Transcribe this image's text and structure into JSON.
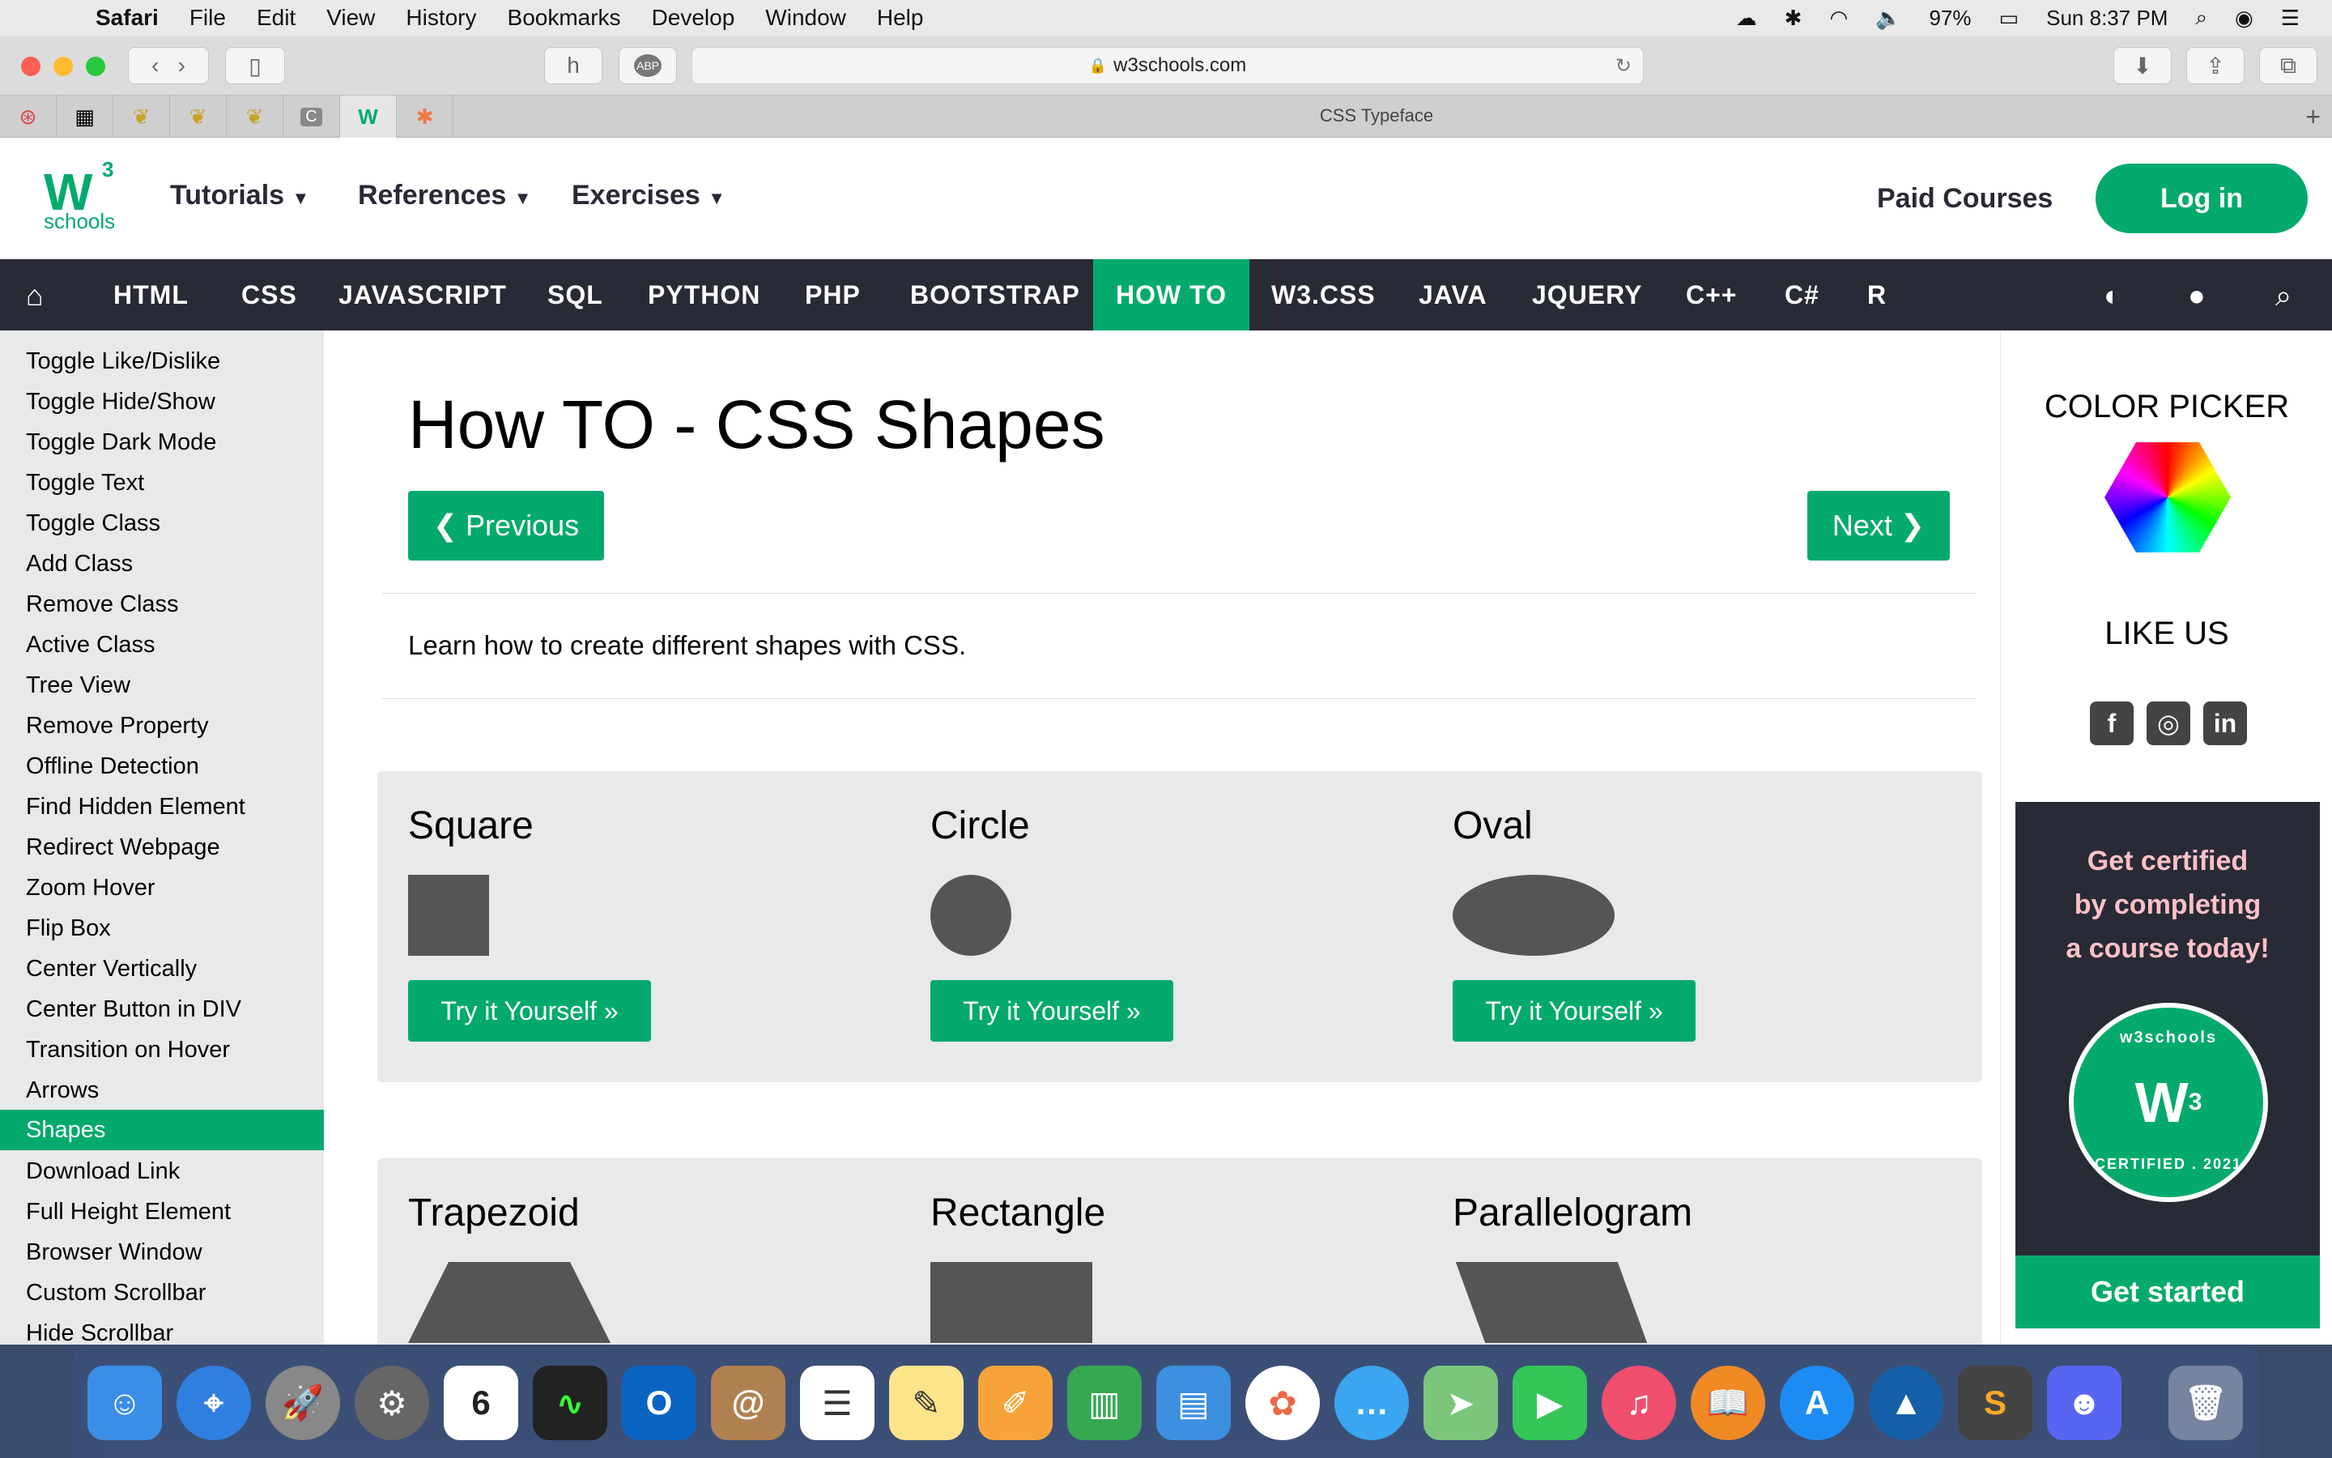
{
  "menubar": {
    "app": "Safari",
    "items": [
      "File",
      "Edit",
      "View",
      "History",
      "Bookmarks",
      "Develop",
      "Window",
      "Help"
    ],
    "battery": "97%",
    "clock": "Sun 8:37 PM"
  },
  "browser": {
    "url": "w3schools.com",
    "tab_title": "CSS Typeface"
  },
  "site": {
    "logo_text": "schools",
    "logo_mark": "W",
    "logo_sup": "3",
    "top_menu": [
      "Tutorials",
      "References",
      "Exercises"
    ],
    "paid_courses": "Paid Courses",
    "login": "Log in",
    "nav": [
      "HTML",
      "CSS",
      "JAVASCRIPT",
      "SQL",
      "PYTHON",
      "PHP",
      "BOOTSTRAP",
      "HOW TO",
      "W3.CSS",
      "JAVA",
      "JQUERY",
      "C++",
      "C#",
      "R"
    ],
    "nav_active": "HOW TO"
  },
  "sidebar": {
    "links": [
      "Toggle Like/Dislike",
      "Toggle Hide/Show",
      "Toggle Dark Mode",
      "Toggle Text",
      "Toggle Class",
      "Add Class",
      "Remove Class",
      "Active Class",
      "Tree View",
      "Remove Property",
      "Offline Detection",
      "Find Hidden Element",
      "Redirect Webpage",
      "Zoom Hover",
      "Flip Box",
      "Center Vertically",
      "Center Button in DIV",
      "Transition on Hover",
      "Arrows",
      "Shapes",
      "Download Link",
      "Full Height Element",
      "Browser Window",
      "Custom Scrollbar",
      "Hide Scrollbar"
    ],
    "active": "Shapes"
  },
  "main": {
    "title": "How TO - CSS Shapes",
    "previous": "❮ Previous",
    "next": "Next ❯",
    "intro": "Learn how to create different shapes with CSS.",
    "shapes_row1": [
      "Square",
      "Circle",
      "Oval"
    ],
    "shapes_row2": [
      "Trapezoid",
      "Rectangle",
      "Parallelogram"
    ],
    "try_label": "Try it Yourself »"
  },
  "right": {
    "color_picker": "COLOR PICKER",
    "like_us": "LIKE US",
    "cert_line1": "Get certified",
    "cert_line2": "by completing",
    "cert_line3": "a course today!",
    "badge_top": "w3schools",
    "badge_bottom": "CERTIFIED . 2021",
    "get_started": "Get started"
  }
}
